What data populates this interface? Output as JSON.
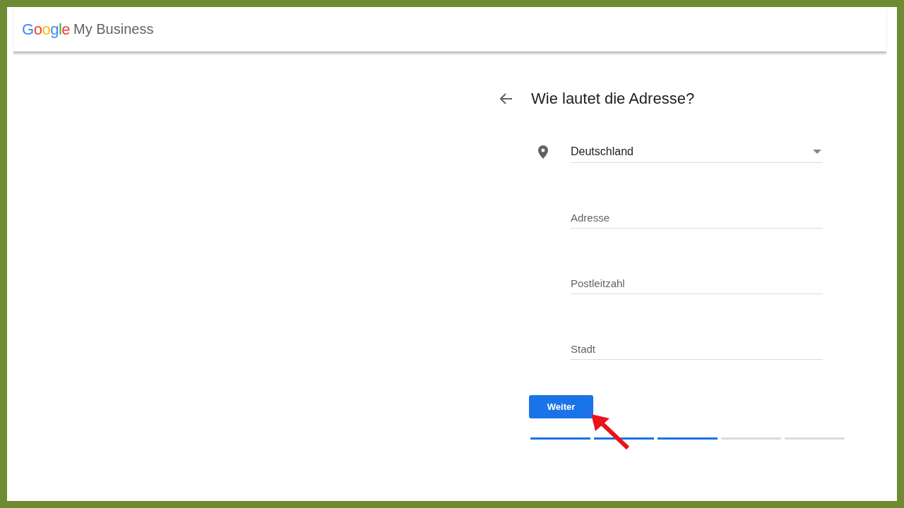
{
  "header": {
    "logo": "Google",
    "product": "My Business"
  },
  "form": {
    "title": "Wie lautet die Adresse?",
    "country": {
      "value": "Deutschland"
    },
    "fields": [
      {
        "placeholder": "Adresse"
      },
      {
        "placeholder": "Postleitzahl"
      },
      {
        "placeholder": "Stadt"
      }
    ],
    "button": "Weiter",
    "steps": [
      {
        "complete": true
      },
      {
        "complete": true
      },
      {
        "complete": true
      },
      {
        "complete": false
      },
      {
        "complete": false
      }
    ]
  }
}
